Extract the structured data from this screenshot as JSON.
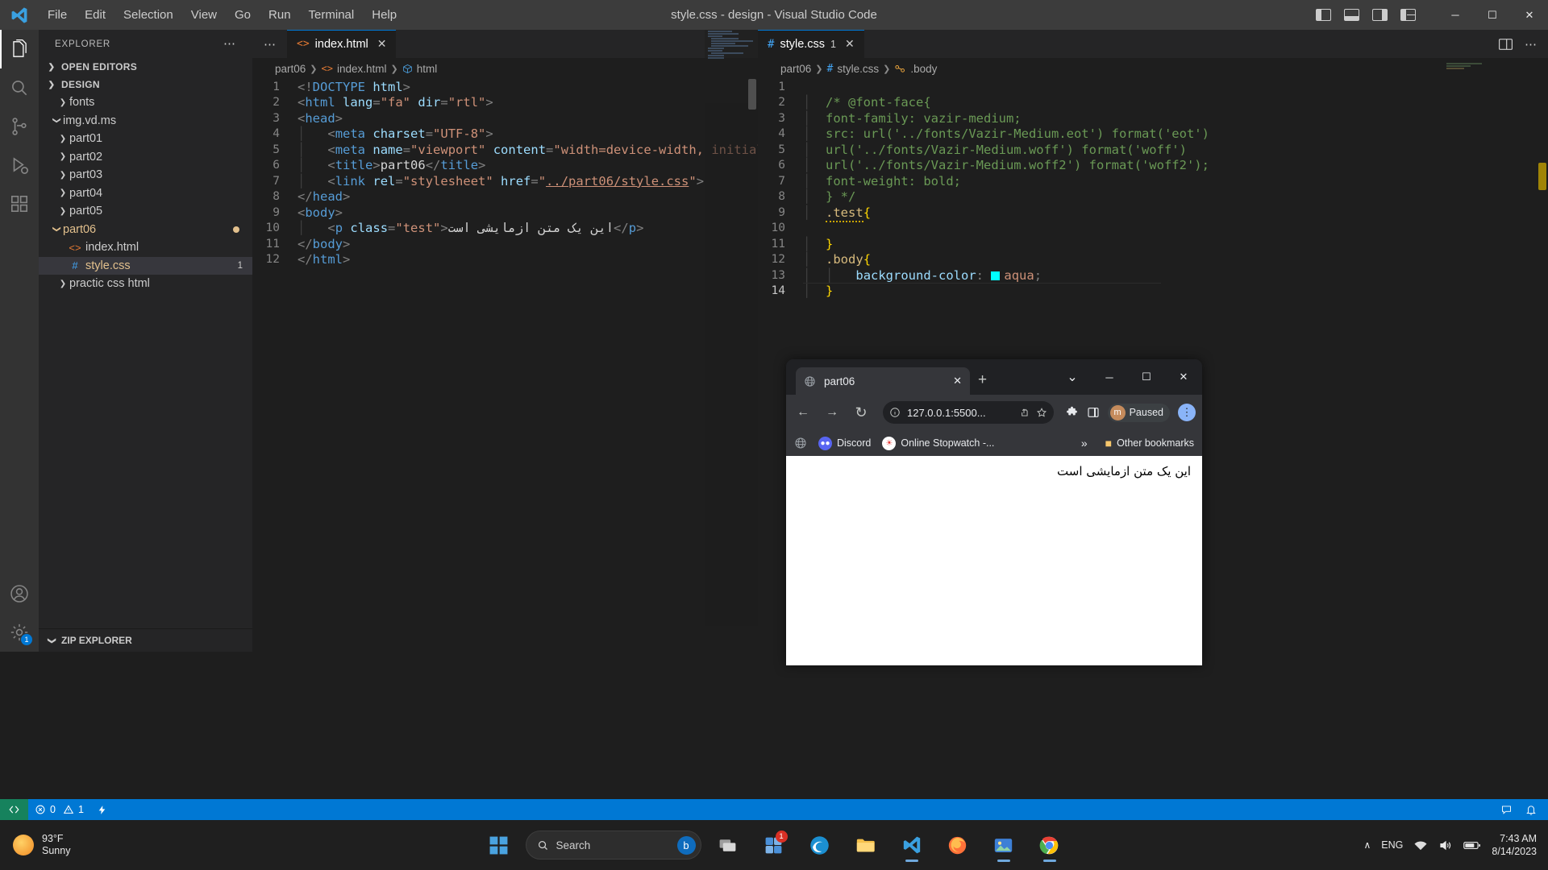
{
  "titlebar": {
    "menus": [
      "File",
      "Edit",
      "Selection",
      "View",
      "Go",
      "Run",
      "Terminal",
      "Help"
    ],
    "window_title": "style.css - design - Visual Studio Code",
    "layout_icons": [
      "panel-left-icon",
      "panel-bottom-icon",
      "panel-right-icon",
      "layout-grid-icon"
    ],
    "minimize": "─",
    "maximize": "☐",
    "close": "✕"
  },
  "activitybar": {
    "items": [
      {
        "name": "explorer",
        "icon": "files-icon",
        "active": true
      },
      {
        "name": "search",
        "icon": "search-icon",
        "active": false
      },
      {
        "name": "source-control",
        "icon": "source-control-icon",
        "active": false
      },
      {
        "name": "run-and-debug",
        "icon": "debug-icon",
        "active": false
      },
      {
        "name": "extensions",
        "icon": "extensions-icon",
        "active": false
      }
    ],
    "bottom": [
      {
        "name": "accounts",
        "icon": "account-icon"
      },
      {
        "name": "settings",
        "icon": "gear-icon",
        "badge": "1"
      }
    ]
  },
  "sidebar": {
    "header_title": "EXPLORER",
    "more_actions": "⋯",
    "open_editors_label": "OPEN EDITORS",
    "project_label": "DESIGN",
    "tree": [
      {
        "label": "fonts",
        "type": "folder",
        "expanded": false,
        "indent": 1
      },
      {
        "label": "img.vd.ms",
        "type": "folder",
        "expanded": true,
        "indent": 1
      },
      {
        "label": "part01",
        "type": "folder",
        "expanded": false,
        "indent": 1
      },
      {
        "label": "part02",
        "type": "folder",
        "expanded": false,
        "indent": 1
      },
      {
        "label": "part03",
        "type": "folder",
        "expanded": false,
        "indent": 1
      },
      {
        "label": "part04",
        "type": "folder",
        "expanded": false,
        "indent": 1
      },
      {
        "label": "part05",
        "type": "folder",
        "expanded": false,
        "indent": 1
      },
      {
        "label": "part06",
        "type": "folder",
        "expanded": true,
        "indent": 1,
        "modified": true,
        "dot": true
      },
      {
        "label": "index.html",
        "type": "html",
        "indent": 2
      },
      {
        "label": "style.css",
        "type": "css",
        "indent": 2,
        "selected": true,
        "modified": true,
        "badge": "1"
      },
      {
        "label": "practic css html",
        "type": "folder",
        "expanded": false,
        "indent": 1
      }
    ],
    "zip_explorer_label": "ZIP EXPLORER"
  },
  "editor_left": {
    "tab": {
      "label": "index.html",
      "icon": "html-icon",
      "close": "✕"
    },
    "more_actions": "⋯",
    "breadcrumb": [
      "part06",
      "index.html",
      "html"
    ],
    "lines": [
      {
        "n": "1",
        "html": "<span class=\"t-punc\">&lt;!</span><span class=\"t-tag\">DOCTYPE</span> <span class=\"t-attr\">html</span><span class=\"t-punc\">&gt;</span>"
      },
      {
        "n": "2",
        "html": "<span class=\"t-punc\">&lt;</span><span class=\"t-tag\">html</span> <span class=\"t-attr\">lang</span><span class=\"t-punc\">=</span><span class=\"t-str\">\"fa\"</span> <span class=\"t-attr\">dir</span><span class=\"t-punc\">=</span><span class=\"t-str\">\"rtl\"</span><span class=\"t-punc\">&gt;</span>"
      },
      {
        "n": "3",
        "html": "<span class=\"t-punc\">&lt;</span><span class=\"t-tag\">head</span><span class=\"t-punc\">&gt;</span>"
      },
      {
        "n": "4",
        "html": "<span class=\"indent-guide\">│</span>   <span class=\"t-punc\">&lt;</span><span class=\"t-tag\">meta</span> <span class=\"t-attr\">charset</span><span class=\"t-punc\">=</span><span class=\"t-str\">\"UTF-8\"</span><span class=\"t-punc\">&gt;</span>"
      },
      {
        "n": "5",
        "html": "<span class=\"indent-guide\">│</span>   <span class=\"t-punc\">&lt;</span><span class=\"t-tag\">meta</span> <span class=\"t-attr\">name</span><span class=\"t-punc\">=</span><span class=\"t-str\">\"viewport\"</span> <span class=\"t-attr\">content</span><span class=\"t-punc\">=</span><span class=\"t-str\">\"width=device-width, initial</span>"
      },
      {
        "n": "6",
        "html": "<span class=\"indent-guide\">│</span>   <span class=\"t-punc\">&lt;</span><span class=\"t-tag\">title</span><span class=\"t-punc\">&gt;</span><span class=\"t-txt\">part06</span><span class=\"t-punc\">&lt;/</span><span class=\"t-tag\">title</span><span class=\"t-punc\">&gt;</span>"
      },
      {
        "n": "7",
        "html": "<span class=\"indent-guide\">│</span>   <span class=\"t-punc\">&lt;</span><span class=\"t-tag\">link</span> <span class=\"t-attr\">rel</span><span class=\"t-punc\">=</span><span class=\"t-str\">\"stylesheet\"</span> <span class=\"t-attr\">href</span><span class=\"t-punc\">=</span><span class=\"t-str\">\"</span><span class=\"t-link\">../part06/style.css</span><span class=\"t-str\">\"</span><span class=\"t-punc\">&gt;</span>"
      },
      {
        "n": "8",
        "html": "<span class=\"t-punc\">&lt;/</span><span class=\"t-tag\">head</span><span class=\"t-punc\">&gt;</span>"
      },
      {
        "n": "9",
        "html": "<span class=\"t-punc\">&lt;</span><span class=\"t-tag\">body</span><span class=\"t-punc\">&gt;</span>"
      },
      {
        "n": "10",
        "html": "<span class=\"indent-guide\">│</span>   <span class=\"t-punc\">&lt;</span><span class=\"t-tag\">p</span> <span class=\"t-attr\">class</span><span class=\"t-punc\">=</span><span class=\"t-str\">\"test\"</span><span class=\"t-punc\">&gt;</span><span class=\"t-txt\">این یک متن ازمایشی است</span><span class=\"t-punc\">&lt;/</span><span class=\"t-tag\">p</span><span class=\"t-punc\">&gt;</span>"
      },
      {
        "n": "11",
        "html": "<span class=\"t-punc\">&lt;/</span><span class=\"t-tag\">body</span><span class=\"t-punc\">&gt;</span>"
      },
      {
        "n": "12",
        "html": "<span class=\"t-punc\">&lt;/</span><span class=\"t-tag\">html</span><span class=\"t-punc\">&gt;</span>"
      }
    ]
  },
  "editor_right": {
    "tab": {
      "label": "style.css",
      "icon": "css-icon",
      "badge": "1",
      "close": "✕"
    },
    "split_icon": "split-editor-icon",
    "more_actions": "⋯",
    "breadcrumb": [
      "part06",
      "style.css",
      ".body"
    ],
    "lines": [
      {
        "n": "1",
        "html": ""
      },
      {
        "n": "2",
        "html": "<span class=\"indent-guide\">│</span>  <span class=\"t-comment\">/* @font-face{</span>"
      },
      {
        "n": "3",
        "html": "<span class=\"indent-guide\">│</span>  <span class=\"t-comment\">font-family: vazir-medium;</span>"
      },
      {
        "n": "4",
        "html": "<span class=\"indent-guide\">│</span>  <span class=\"t-comment\">src: url('../fonts/Vazir-Medium.eot') format('eot')</span>"
      },
      {
        "n": "5",
        "html": "<span class=\"indent-guide\">│</span>  <span class=\"t-comment\">url('../fonts/Vazir-Medium.woff') format('woff')</span>"
      },
      {
        "n": "6",
        "html": "<span class=\"indent-guide\">│</span>  <span class=\"t-comment\">url('../fonts/Vazir-Medium.woff2') format('woff2');</span>"
      },
      {
        "n": "7",
        "html": "<span class=\"indent-guide\">│</span>  <span class=\"t-comment\">font-weight: bold;</span>"
      },
      {
        "n": "8",
        "html": "<span class=\"indent-guide\">│</span>  <span class=\"t-comment\">} */</span>"
      },
      {
        "n": "9",
        "html": "<span class=\"indent-guide\">│</span>  <span class=\"t-sel squiggle\">.test</span><span class=\"t-brace\">{</span>"
      },
      {
        "n": "10",
        "html": ""
      },
      {
        "n": "11",
        "html": "<span class=\"indent-guide\">│</span>  <span class=\"t-brace\">}</span>"
      },
      {
        "n": "12",
        "html": "<span class=\"indent-guide\">│</span>  <span class=\"t-sel\">.body</span><span class=\"t-brace\">{</span>"
      },
      {
        "n": "13",
        "html": "<span class=\"indent-guide\">│</span>  <span class=\"indent-guide\">│</span>   <span class=\"t-prop\">background-color</span><span class=\"t-punc\">:</span> <span class=\"color-swatch\"></span><span class=\"t-val\">aqua</span><span class=\"t-punc\">;</span>"
      },
      {
        "n": "14",
        "html": "<span class=\"indent-guide\">│</span>  <span class=\"t-brace\">}</span>"
      }
    ]
  },
  "browser": {
    "tab_title": "part06",
    "tab_favicon": "globe-icon",
    "tab_close": "✕",
    "new_tab": "+",
    "window_controls": {
      "minimize_group": "⌄",
      "minimize": "─",
      "maximize": "☐",
      "close": "✕"
    },
    "nav": {
      "back": "←",
      "forward": "→",
      "reload": "↻"
    },
    "site_info_icon": "info-circle-icon",
    "url": "127.0.0.1:5500...",
    "share_icon": "share-icon",
    "bookmark_icon": "star-icon",
    "extensions_icon": "puzzle-icon",
    "side_panel_icon": "sidepanel-icon",
    "profile": {
      "avatar_letter": "m",
      "label": "Paused"
    },
    "menu_icon": "three-dots-icon",
    "bookmarks": [
      {
        "label": "",
        "icon": "globe-icon"
      },
      {
        "label": "Discord",
        "icon": "discord-icon"
      },
      {
        "label": "Online Stopwatch -...",
        "icon": "stopwatch-icon"
      }
    ],
    "bookmarks_overflow": "»",
    "other_bookmarks": {
      "label": "Other bookmarks",
      "icon": "folder-icon"
    },
    "page_text": "این یک متن ازمایشی است"
  },
  "statusbar": {
    "remote_icon": "remote-window-icon",
    "errors": "0",
    "warnings": "1",
    "radio_icon": "live-server-icon",
    "right_icons": [
      "feedback-icon",
      "bell-icon"
    ]
  },
  "taskbar": {
    "weather": {
      "temp": "93°F",
      "condition": "Sunny"
    },
    "start_icon": "windows-start-icon",
    "search_placeholder": "Search",
    "search_icon": "search-icon",
    "copilot_icon": "bing-chat-icon",
    "apps": [
      {
        "name": "task-view",
        "icon": "task-view-icon"
      },
      {
        "name": "widgets",
        "icon": "widgets-icon",
        "badge": "1"
      },
      {
        "name": "edge",
        "icon": "edge-icon"
      },
      {
        "name": "file-explorer",
        "icon": "folder-icon"
      },
      {
        "name": "vscode",
        "icon": "vscode-icon",
        "running": true
      },
      {
        "name": "firefox",
        "icon": "firefox-icon"
      },
      {
        "name": "photos",
        "icon": "photos-icon",
        "running": true
      },
      {
        "name": "chrome",
        "icon": "chrome-icon",
        "running": true
      }
    ],
    "tray": {
      "chevron": "∧",
      "language": "ENG",
      "wifi_icon": "wifi-icon",
      "volume_icon": "volume-icon",
      "battery_icon": "battery-icon",
      "time": "7:43 AM",
      "date": "8/14/2023"
    }
  },
  "colors": {
    "accent": "#0078d4",
    "modified": "#e2c08d",
    "aqua": "#00ffff",
    "warning": "#cca700"
  }
}
